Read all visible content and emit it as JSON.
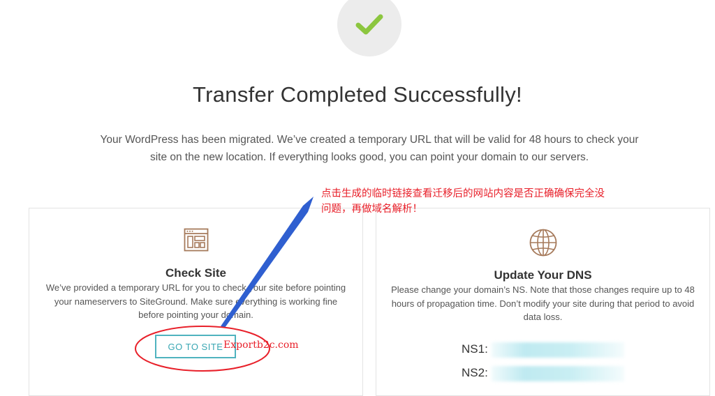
{
  "hero": {
    "status_icon": "checkmark-icon",
    "title": "Transfer Completed Successfully!",
    "description": "Your WordPress has been migrated. We’ve created a temporary URL that will be valid for 48 hours to check your site on the new location. If everything looks good, you can point your domain to our servers."
  },
  "check_site": {
    "icon": "browser-layout-icon",
    "title": "Check Site",
    "body": "We’ve provided a temporary URL for you to check your site before pointing your nameservers to SiteGround. Make sure everything is working fine before pointing your domain.",
    "button_label": "GO TO SITE"
  },
  "dns": {
    "icon": "globe-icon",
    "title": "Update Your DNS",
    "body": "Please change your domain’s NS. Note that those changes require up to 48 hours of propagation time. Don’t modify your site during that period to avoid data loss.",
    "ns1_label": "NS1:",
    "ns2_label": "NS2:"
  },
  "annotation": {
    "note": "点击生成的临时链接查看迁移后的网站内容是否正确确保完全没问题，再做域名解析！",
    "watermark": "Exportb2c.com",
    "color": "#e8202a",
    "arrow_color": "#2f5fd0"
  },
  "colors": {
    "success_green": "#8cc63f",
    "accent_teal": "#4fb3bf",
    "icon_brown": "#a67a5b"
  }
}
